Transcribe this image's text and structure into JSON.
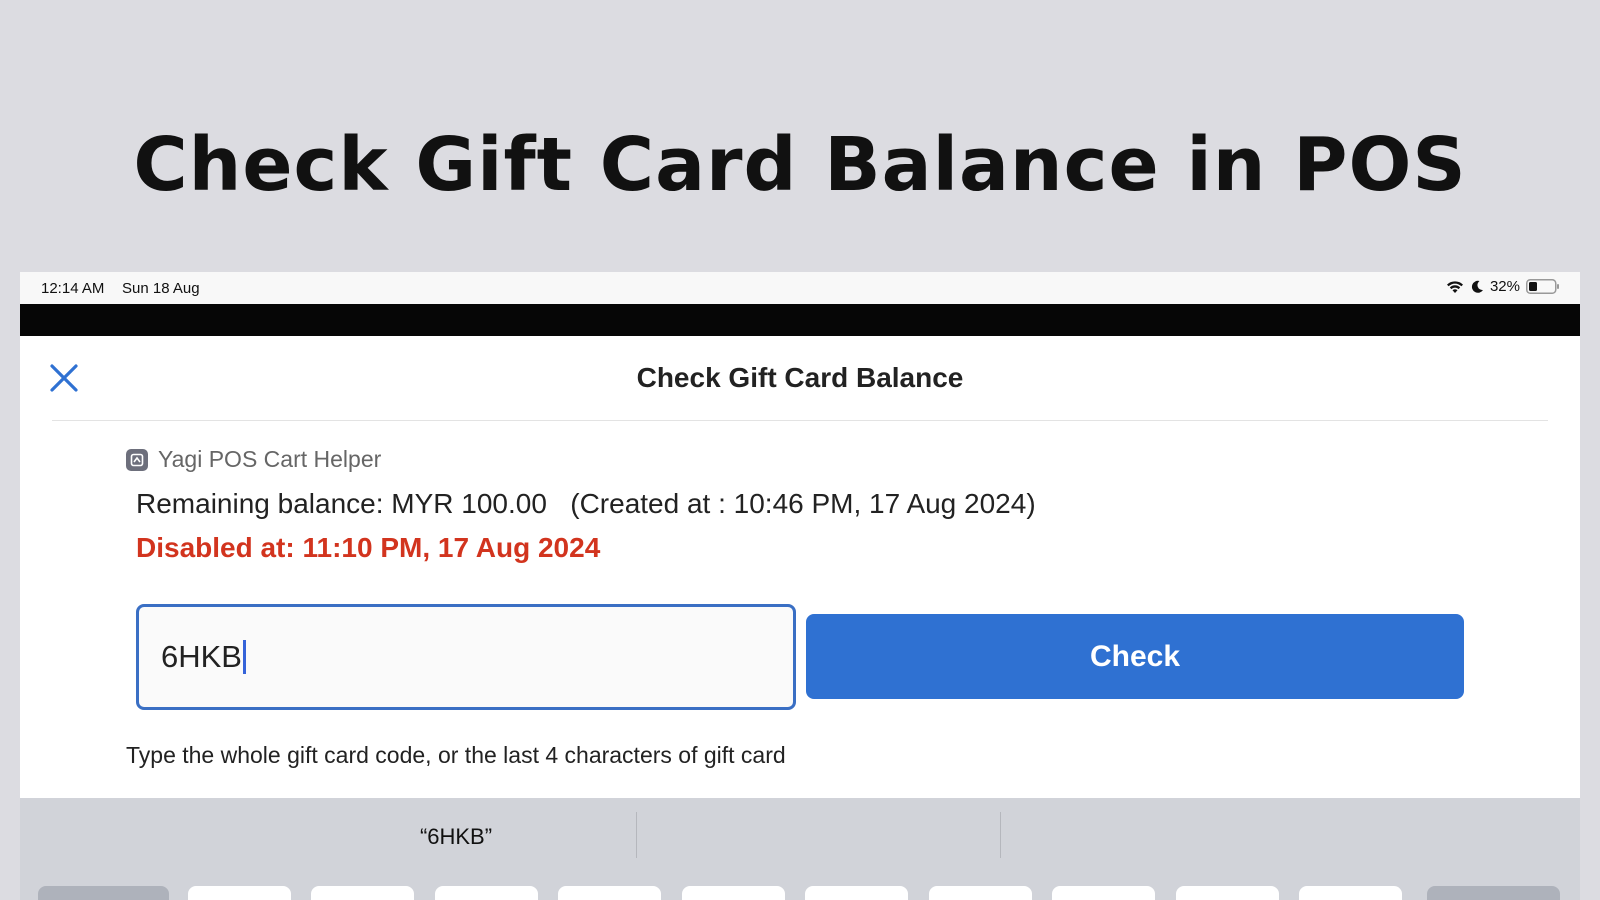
{
  "headline": "Check Gift Card Balance in POS",
  "status_bar": {
    "time": "12:14 AM",
    "date": "Sun 18 Aug",
    "battery": "32%"
  },
  "sheet": {
    "title": "Check Gift Card Balance",
    "app_name": "Yagi POS Cart Helper",
    "remaining_balance": "Remaining balance: MYR 100.00   (Created at : 10:46 PM, 17 Aug 2024)",
    "disabled_at": "Disabled at: 11:10 PM, 17 Aug 2024",
    "input_value": "6HKB",
    "check_label": "Check",
    "hint": "Type the whole gift card code, or the last 4 characters of gift card"
  },
  "keyboard": {
    "suggestion": "“6HKB”"
  },
  "colors": {
    "accent": "#2f71d2",
    "error": "#d2341e",
    "background": "#dcdce1"
  }
}
